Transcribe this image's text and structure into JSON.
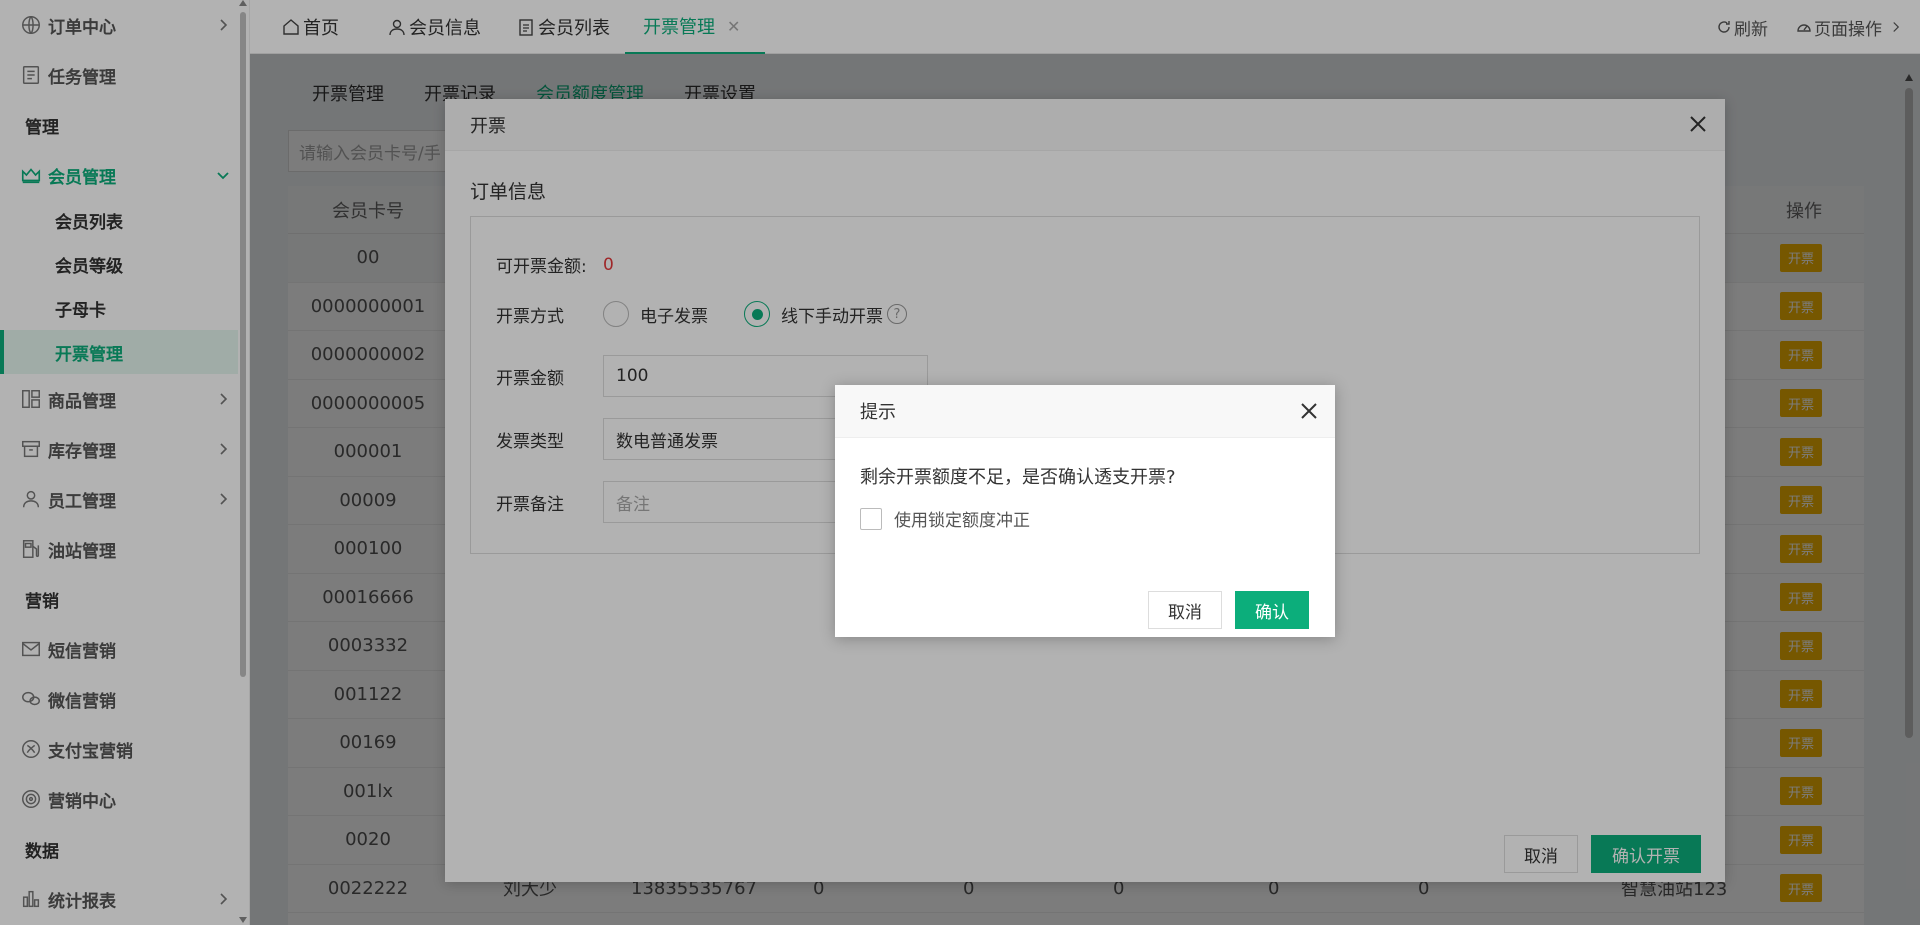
{
  "sidebar": {
    "items": [
      {
        "label": "订单中心",
        "icon": "globe-icon",
        "chevron": true
      },
      {
        "label": "任务管理",
        "icon": "task-icon",
        "chevron": false
      },
      {
        "label": "管理",
        "section": true
      },
      {
        "label": "会员管理",
        "icon": "crown-icon",
        "chevron": true,
        "expanded": true
      },
      {
        "label": "商品管理",
        "icon": "grid-icon",
        "chevron": true
      },
      {
        "label": "库存管理",
        "icon": "box-icon",
        "chevron": true
      },
      {
        "label": "员工管理",
        "icon": "user-icon",
        "chevron": true
      },
      {
        "label": "油站管理",
        "icon": "fuel-icon",
        "chevron": false
      },
      {
        "label": "营销",
        "section": true
      },
      {
        "label": "短信营销",
        "icon": "mail-icon",
        "chevron": false
      },
      {
        "label": "微信营销",
        "icon": "wechat-icon",
        "chevron": false
      },
      {
        "label": "支付宝营销",
        "icon": "alipay-icon",
        "chevron": false
      },
      {
        "label": "营销中心",
        "icon": "target-icon",
        "chevron": false
      },
      {
        "label": "数据",
        "section": true
      },
      {
        "label": "统计报表",
        "icon": "chart-icon",
        "chevron": true
      }
    ],
    "sub_items": [
      {
        "label": "会员列表"
      },
      {
        "label": "会员等级"
      },
      {
        "label": "子母卡"
      },
      {
        "label": "开票管理",
        "active": true
      }
    ]
  },
  "topbar": {
    "tabs": [
      {
        "label": "首页",
        "icon": "home-icon"
      },
      {
        "label": "会员信息",
        "icon": "user-icon"
      },
      {
        "label": "会员列表",
        "icon": "clipboard-icon"
      },
      {
        "label": "开票管理",
        "active": true,
        "closable": true
      }
    ],
    "refresh": "刷新",
    "page_ops": "页面操作"
  },
  "main": {
    "subtabs": [
      "开票管理",
      "开票记录",
      "会员额度管理",
      "开票设置"
    ],
    "active_subtab": 2,
    "search_placeholder": "请输入会员卡号/手",
    "col_card": "会员卡号",
    "col_op": "操作",
    "op_label": "开票",
    "rows": [
      "00",
      "0000000001",
      "0000000002",
      "0000000005",
      "000001",
      "00009",
      "000100",
      "00016666",
      "0003332",
      "001122",
      "00169",
      "001lx",
      "0020",
      "0022222"
    ],
    "last_row_extra": {
      "name": "刘大少",
      "phone": "13835535767",
      "zeros": [
        "0",
        "0",
        "0",
        "0",
        "0"
      ],
      "station": "智慧油站123"
    }
  },
  "invoice_dialog": {
    "title": "开票",
    "section_title": "订单信息",
    "available_label": "可开票金额:",
    "available_value": "0",
    "method_label": "开票方式",
    "method_options": [
      "电子发票",
      "线下手动开票"
    ],
    "method_selected": 1,
    "amount_label": "开票金额",
    "amount_value": "100",
    "type_label": "发票类型",
    "type_value": "数电普通发票",
    "remark_label": "开票备注",
    "remark_placeholder": "备注",
    "cancel": "取消",
    "confirm": "确认开票"
  },
  "prompt_dialog": {
    "title": "提示",
    "message": "剩余开票额度不足，是否确认透支开票?",
    "checkbox_label": "使用锁定额度冲正",
    "cancel": "取消",
    "confirm": "确认"
  },
  "colors": {
    "accent": "#0cae7b",
    "warn_btn": "#f4b400",
    "amount": "#e4393c"
  }
}
